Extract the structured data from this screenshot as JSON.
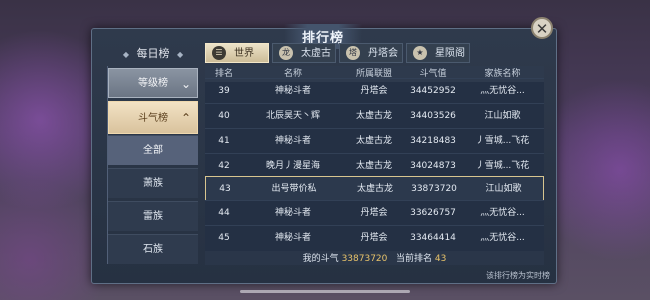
{
  "title": "排行榜",
  "close_icon": "close-icon",
  "daily": {
    "label": "每日榜",
    "ornament": "◆"
  },
  "categories": [
    {
      "label": "等级榜",
      "chevron": "⌄"
    },
    {
      "label": "斗气榜",
      "chevron": "⌃"
    }
  ],
  "subcategories": [
    "全部",
    "萧族",
    "雷族",
    "石族"
  ],
  "tabs": [
    {
      "label": "世界",
      "icon": "book-icon",
      "glyph": "☰"
    },
    {
      "label": "太虚古龙",
      "icon": "dragon-icon",
      "glyph": "龙"
    },
    {
      "label": "丹塔会",
      "icon": "pagoda-icon",
      "glyph": "塔"
    },
    {
      "label": "星陨阁",
      "icon": "star-pavilion-icon",
      "glyph": "★"
    }
  ],
  "columns": [
    "排名",
    "名称",
    "所属联盟",
    "斗气值",
    "家族名称"
  ],
  "rows": [
    [
      "39",
      "神秘斗者",
      "丹塔会",
      "34452952",
      "灬无忧谷..."
    ],
    [
      "40",
      "北辰昊天丶辉",
      "太虚古龙",
      "34403526",
      "江山如歌"
    ],
    [
      "41",
      "神秘斗者",
      "太虚古龙",
      "34218483",
      "丿雪城...飞花"
    ],
    [
      "42",
      "晚月丿漫星海",
      "太虚古龙",
      "34024873",
      "丿雪城...飞花"
    ],
    [
      "43",
      "出号带价私",
      "太虚古龙",
      "33873720",
      "江山如歌"
    ],
    [
      "44",
      "神秘斗者",
      "丹塔会",
      "33626757",
      "灬无忧谷..."
    ],
    [
      "45",
      "神秘斗者",
      "丹塔会",
      "33464414",
      "灬无忧谷..."
    ]
  ],
  "footer": {
    "my_label": "我的斗气",
    "my_value": "33873720",
    "rank_label": "当前排名",
    "rank_value": "43"
  },
  "note": "该排行榜为实时榜"
}
